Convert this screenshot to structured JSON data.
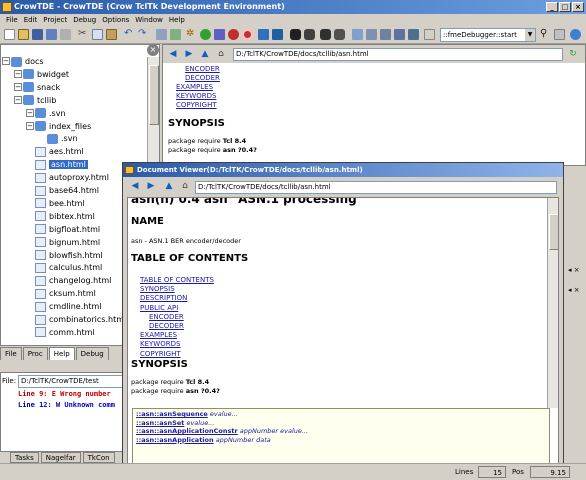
{
  "window": {
    "title": "CrowTDE - CrowTDE (Crow TclTk Development Environment)"
  },
  "menu": [
    "File",
    "Edit",
    "Project",
    "Debug",
    "Options",
    "Window",
    "Help"
  ],
  "toolbar": {
    "proc_combo": "::fmeDebugger::start"
  },
  "tree": {
    "items": [
      {
        "label": "docs",
        "type": "folder",
        "depth": 0
      },
      {
        "label": "bwidget",
        "type": "folder",
        "depth": 1
      },
      {
        "label": "snack",
        "type": "folder",
        "depth": 1
      },
      {
        "label": "tcllib",
        "type": "folder",
        "depth": 1
      },
      {
        "label": ".svn",
        "type": "folder",
        "depth": 2
      },
      {
        "label": "index_files",
        "type": "folder",
        "depth": 2
      },
      {
        "label": ".svn",
        "type": "folder",
        "depth": 3
      },
      {
        "label": "aes.html",
        "type": "file",
        "depth": 2
      },
      {
        "label": "asn.html",
        "type": "file",
        "depth": 2,
        "selected": true
      },
      {
        "label": "autoproxy.html",
        "type": "file",
        "depth": 2
      },
      {
        "label": "base64.html",
        "type": "file",
        "depth": 2
      },
      {
        "label": "bee.html",
        "type": "file",
        "depth": 2
      },
      {
        "label": "bibtex.html",
        "type": "file",
        "depth": 2
      },
      {
        "label": "bigfloat.html",
        "type": "file",
        "depth": 2
      },
      {
        "label": "bignum.html",
        "type": "file",
        "depth": 2
      },
      {
        "label": "blowfish.html",
        "type": "file",
        "depth": 2
      },
      {
        "label": "calculus.html",
        "type": "file",
        "depth": 2
      },
      {
        "label": "changelog.html",
        "type": "file",
        "depth": 2
      },
      {
        "label": "cksum.html",
        "type": "file",
        "depth": 2
      },
      {
        "label": "cmdline.html",
        "type": "file",
        "depth": 2
      },
      {
        "label": "combinatorics.html",
        "type": "file",
        "depth": 2
      },
      {
        "label": "comm.html",
        "type": "file",
        "depth": 2
      }
    ]
  },
  "left_tabs": [
    "File",
    "Proc",
    "Help",
    "Debug"
  ],
  "bottom": {
    "file_label": "File:",
    "file_value": "D:/TclTK/CrowTDE/test",
    "lines": [
      {
        "text": "Line   9: E Wrong number",
        "color": "#c00000"
      },
      {
        "text": "Line  12: W Unknown comm",
        "color": "#0000c0"
      }
    ],
    "tabs": [
      "Tasks",
      "Nagelfar",
      "TkCon"
    ]
  },
  "status": {
    "lines_label": "Lines",
    "lines_value": "15",
    "pos_label": "Pos",
    "pos_value": "9.15"
  },
  "doc": {
    "url": "D:/TclTK/CrowTDE/docs/tcllib/asn.html",
    "links": [
      "ENCODER",
      "DECODER",
      "EXAMPLES",
      "KEYWORDS",
      "COPYRIGHT"
    ],
    "synopsis_heading": "SYNOPSIS",
    "req1_prefix": "package require ",
    "req1_bold": "Tcl 8.4",
    "req2_prefix": "package require ",
    "req2_bold": "asn ?0.4?"
  },
  "viewer": {
    "title": "Document Viewer(D:/TclTK/CrowTDE/docs/tcllib/asn.html)",
    "url": "D:/TclTK/CrowTDE/docs/tcllib/asn.html",
    "top_heading": "asn(n) 0.4 asn \"ASN.1 processing\"",
    "name_heading": "NAME",
    "name_text": "asn - ASN.1 BER encoder/decoder",
    "toc_heading": "TABLE OF CONTENTS",
    "toc": [
      {
        "label": "TABLE OF CONTENTS",
        "indent": 0
      },
      {
        "label": "SYNOPSIS",
        "indent": 0
      },
      {
        "label": "DESCRIPTION",
        "indent": 0
      },
      {
        "label": "PUBLIC API",
        "indent": 0
      },
      {
        "label": "ENCODER",
        "indent": 1
      },
      {
        "label": "DECODER",
        "indent": 1
      },
      {
        "label": "EXAMPLES",
        "indent": 0
      },
      {
        "label": "KEYWORDS",
        "indent": 0
      },
      {
        "label": "COPYRIGHT",
        "indent": 0
      }
    ],
    "synopsis_heading": "SYNOPSIS",
    "req1_prefix": "package require ",
    "req1_bold": "Tcl 8.4",
    "req2_prefix": "package require ",
    "req2_bold": "asn ?0.4?",
    "code": [
      {
        "cmd": "::asn::asnSequence",
        "args": "evalue..."
      },
      {
        "cmd": "::asn::asnSet",
        "args": "evalue..."
      },
      {
        "cmd": "::asn::asnApplicationConstr",
        "args": "appNumber evalue..."
      },
      {
        "cmd": "::asn::asnApplication",
        "args": "appNumber data"
      }
    ]
  }
}
